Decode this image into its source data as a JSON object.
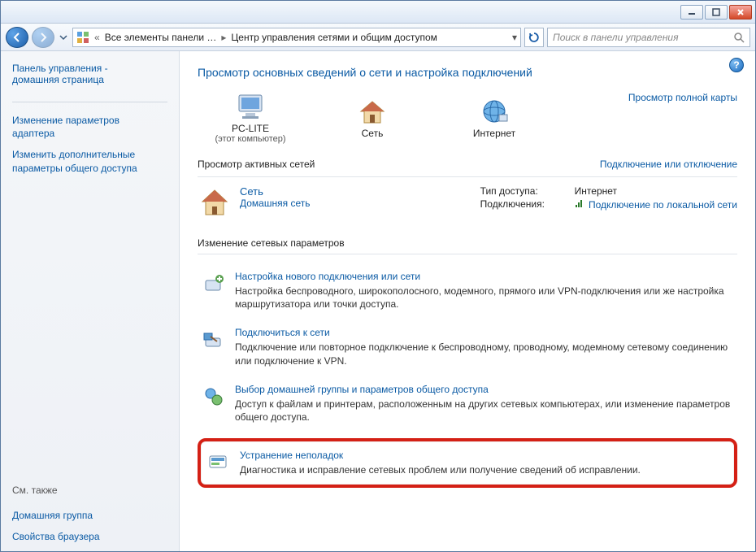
{
  "window": {
    "breadcrumb_root": "Все элементы панели …",
    "breadcrumb_current": "Центр управления сетями и общим доступом",
    "search_placeholder": "Поиск в панели управления"
  },
  "sidebar": {
    "home_line1": "Панель управления -",
    "home_line2": "домашняя страница",
    "link_adapter_line1": "Изменение параметров",
    "link_adapter_line2": "адаптера",
    "link_sharing_line1": "Изменить дополнительные",
    "link_sharing_line2": "параметры общего доступа",
    "seealso_title": "См. также",
    "seealso_homegroup": "Домашняя группа",
    "seealso_browser": "Свойства браузера"
  },
  "content": {
    "heading": "Просмотр основных сведений о сети и настройка подключений",
    "map": {
      "pc_label": "PC-LITE",
      "pc_sub": "(этот компьютер)",
      "net_label": "Сеть",
      "inet_label": "Интернет",
      "fullmap_link": "Просмотр полной карты"
    },
    "active_networks_title": "Просмотр активных сетей",
    "connect_disconnect": "Подключение или отключение",
    "active": {
      "name": "Сеть",
      "type": "Домашняя сеть",
      "access_key": "Тип доступа:",
      "access_val": "Интернет",
      "conn_key": "Подключения:",
      "conn_val": "Подключение по локальной сети"
    },
    "change_settings_title": "Изменение сетевых параметров",
    "tasks": [
      {
        "title": "Настройка нового подключения или сети",
        "desc": "Настройка беспроводного, широкополосного, модемного, прямого или VPN-подключения или же настройка маршрутизатора или точки доступа."
      },
      {
        "title": "Подключиться к сети",
        "desc": "Подключение или повторное подключение к беспроводному, проводному, модемному сетевому соединению или подключение к VPN."
      },
      {
        "title": "Выбор домашней группы и параметров общего доступа",
        "desc": "Доступ к файлам и принтерам, расположенным на других сетевых компьютерах, или изменение параметров общего доступа."
      },
      {
        "title": "Устранение неполадок",
        "desc": "Диагностика и исправление сетевых проблем или получение сведений об исправлении."
      }
    ]
  }
}
